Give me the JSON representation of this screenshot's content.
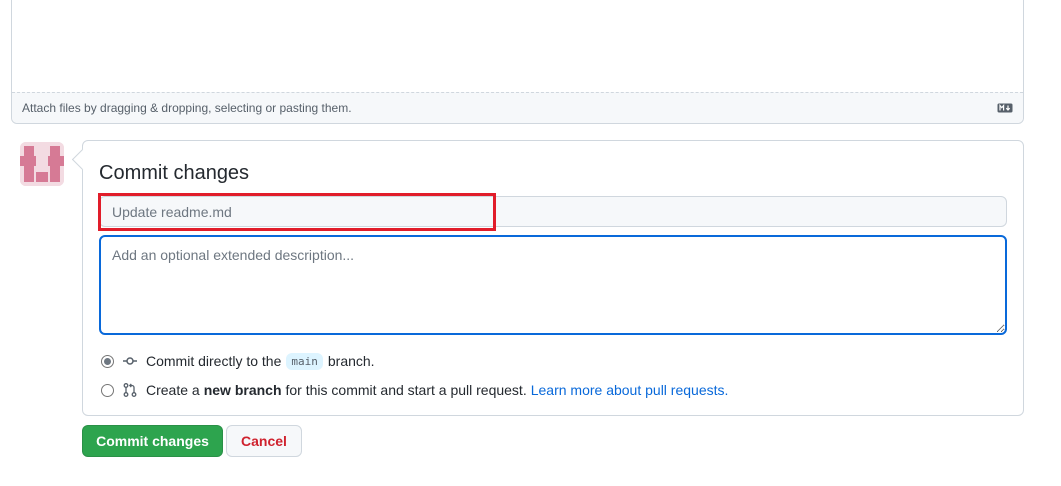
{
  "attach_bar": {
    "text": "Attach files by dragging & dropping, selecting or pasting them.",
    "markdown_icon": "markdown-icon"
  },
  "commit": {
    "title": "Commit changes",
    "summary_placeholder": "Update readme.md",
    "description_placeholder": "Add an optional extended description...",
    "options": {
      "direct": {
        "icon": "git-commit-icon",
        "text_before": "Commit directly to the",
        "branch": "main",
        "text_after": "branch.",
        "selected": true
      },
      "new_branch": {
        "icon": "git-pull-request-icon",
        "text_before": "Create a",
        "bold": "new branch",
        "text_after": "for this commit and start a pull request.",
        "link": "Learn more about pull requests.",
        "selected": false
      }
    }
  },
  "buttons": {
    "commit_label": "Commit changes",
    "cancel_label": "Cancel"
  },
  "colors": {
    "primary": "#2da44e",
    "danger": "#cf222e",
    "link": "#0969da",
    "highlight": "#e11d2a"
  }
}
